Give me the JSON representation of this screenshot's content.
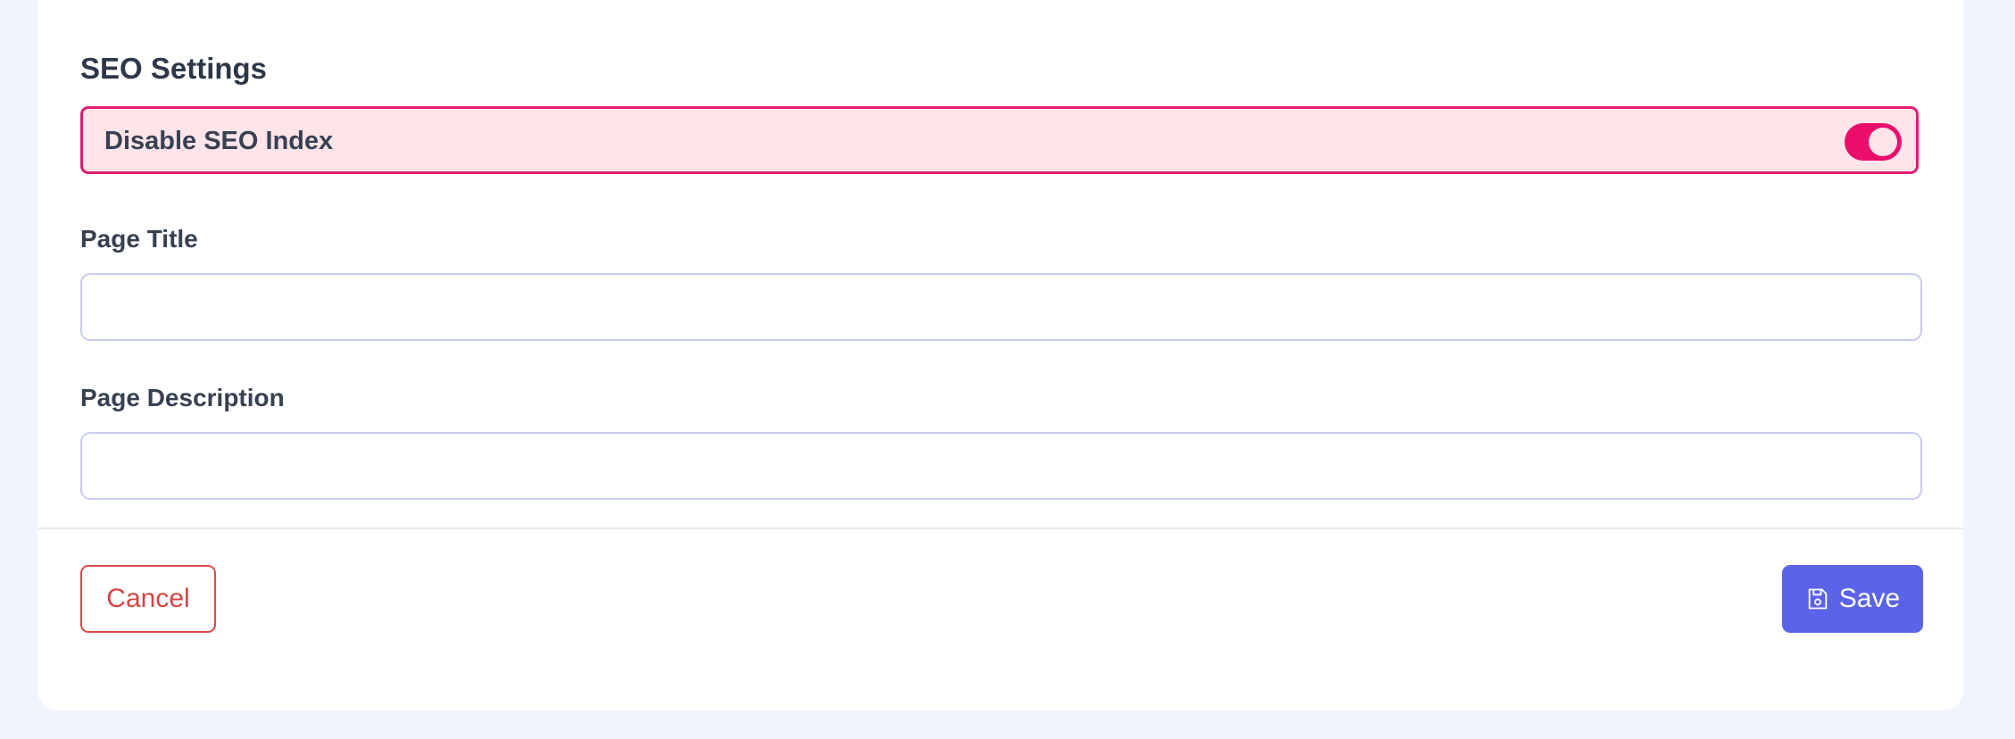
{
  "seo": {
    "section_title": "SEO Settings",
    "disable_index": {
      "label": "Disable SEO Index",
      "enabled": true
    },
    "page_title": {
      "label": "Page Title",
      "value": "",
      "placeholder": ""
    },
    "page_description": {
      "label": "Page Description",
      "value": "",
      "placeholder": ""
    }
  },
  "actions": {
    "cancel_label": "Cancel",
    "save_label": "Save",
    "save_icon": "floppy-disk-icon"
  },
  "colors": {
    "page_background": "#f1f3fd",
    "toggle_accent": "#ea0f6b",
    "toggle_row_background": "#ffe4ea",
    "primary_button": "#5b63e8",
    "danger": "#d64545",
    "input_border": "#c7cbee"
  }
}
